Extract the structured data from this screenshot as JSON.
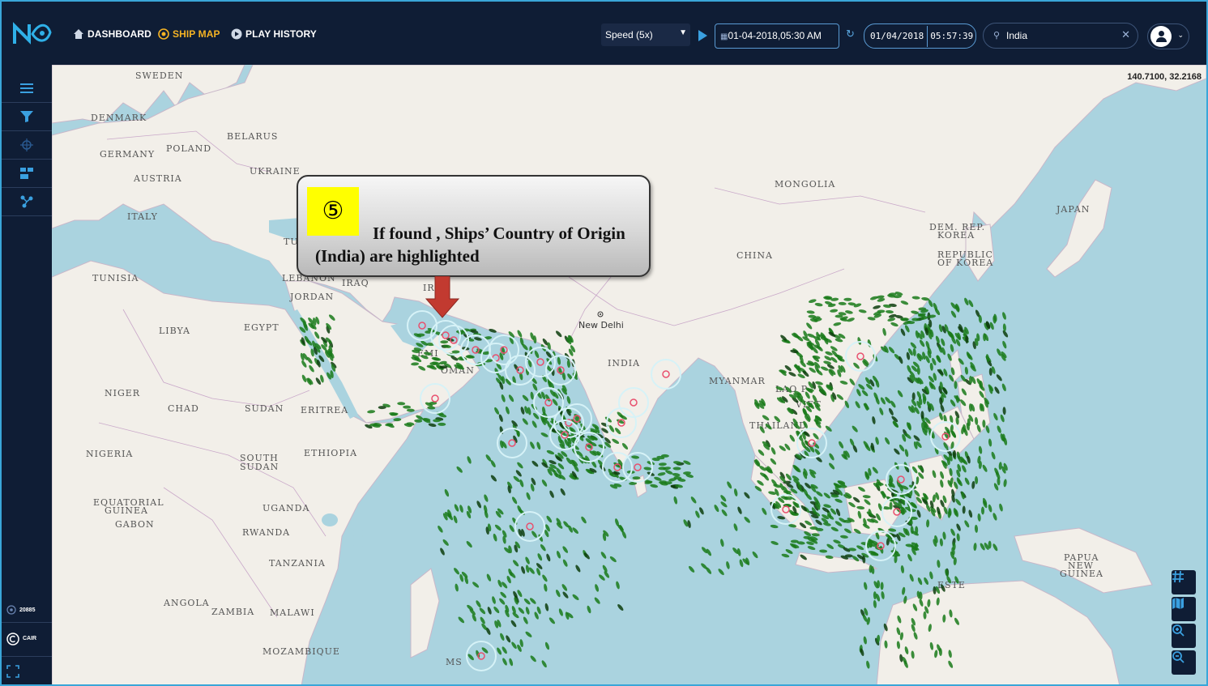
{
  "nav": {
    "dashboard": "DASHBOARD",
    "ship_map": "SHIP MAP",
    "play_history": "PLAY HISTORY"
  },
  "controls": {
    "speed": "Speed (5x)",
    "datetime": "01-04-2018,05:30 AM",
    "clock_date": "01/04/2018",
    "clock_time": "05:57:39",
    "search_value": "India"
  },
  "sidebar": {
    "ship_count": "20885",
    "brand": "CAIR"
  },
  "map": {
    "coordinates": "140.7100, 32.2168",
    "water_color": "#aad3df",
    "land_color": "#f2efe9",
    "ship_color": "#1a7a1a",
    "highlight_color": "#e8506e",
    "labels": {
      "sweden": "SWEDEN",
      "denmark": "DENMARK",
      "belarus": "BELARUS",
      "germany": "GERMANY",
      "poland": "POLAND",
      "ukraine": "UKRAINE",
      "austria": "AUSTRIA",
      "italy": "ITALY",
      "tunisia": "TUNISIA",
      "libya": "LIBYA",
      "egypt": "EGYPT",
      "lebanon": "LEBANON",
      "jordan": "JORDAN",
      "iraq": "IRAQ",
      "tu": "TU",
      "ir": "IR",
      "emi": "EMI",
      "oman": "OMAN",
      "niger": "NIGER",
      "chad": "CHAD",
      "sudan": "SUDAN",
      "eritrea": "ERITREA",
      "nigeria": "NIGERIA",
      "south_sudan_1": "SOUTH",
      "south_sudan_2": "SUDAN",
      "ethiopia": "ETHIOPIA",
      "eq_guinea_1": "EQUATORIAL",
      "eq_guinea_2": "GUINEA",
      "gabon": "GABON",
      "uganda": "UGANDA",
      "rwanda": "RWANDA",
      "tanzania": "TANZANIA",
      "angola": "ANGOLA",
      "zambia": "ZAMBIA",
      "malawi": "MALAWI",
      "mozambique": "MOZAMBIQUE",
      "mongolia": "MONGOLIA",
      "china": "CHINA",
      "japan": "JAPAN",
      "dprk_1": "DEM. REP.",
      "dprk_2": "KOREA",
      "rok_1": "REPUBLIC",
      "rok_2": "OF KOREA",
      "india": "INDIA",
      "new_delhi": "New Delhi",
      "myanmar": "MYANMAR",
      "laos": "LAO P",
      "viet": "VIET",
      "thailand": "THAILAND",
      "png_1": "PAPUA",
      "png_2": "NEW",
      "png_3": "GUINEA",
      "este": "ESTE",
      "ms": "MS"
    }
  },
  "callout": {
    "step": "⑤",
    "line1": "If found , Ships’ Country of Origin",
    "line2": "(India) are highlighted"
  }
}
